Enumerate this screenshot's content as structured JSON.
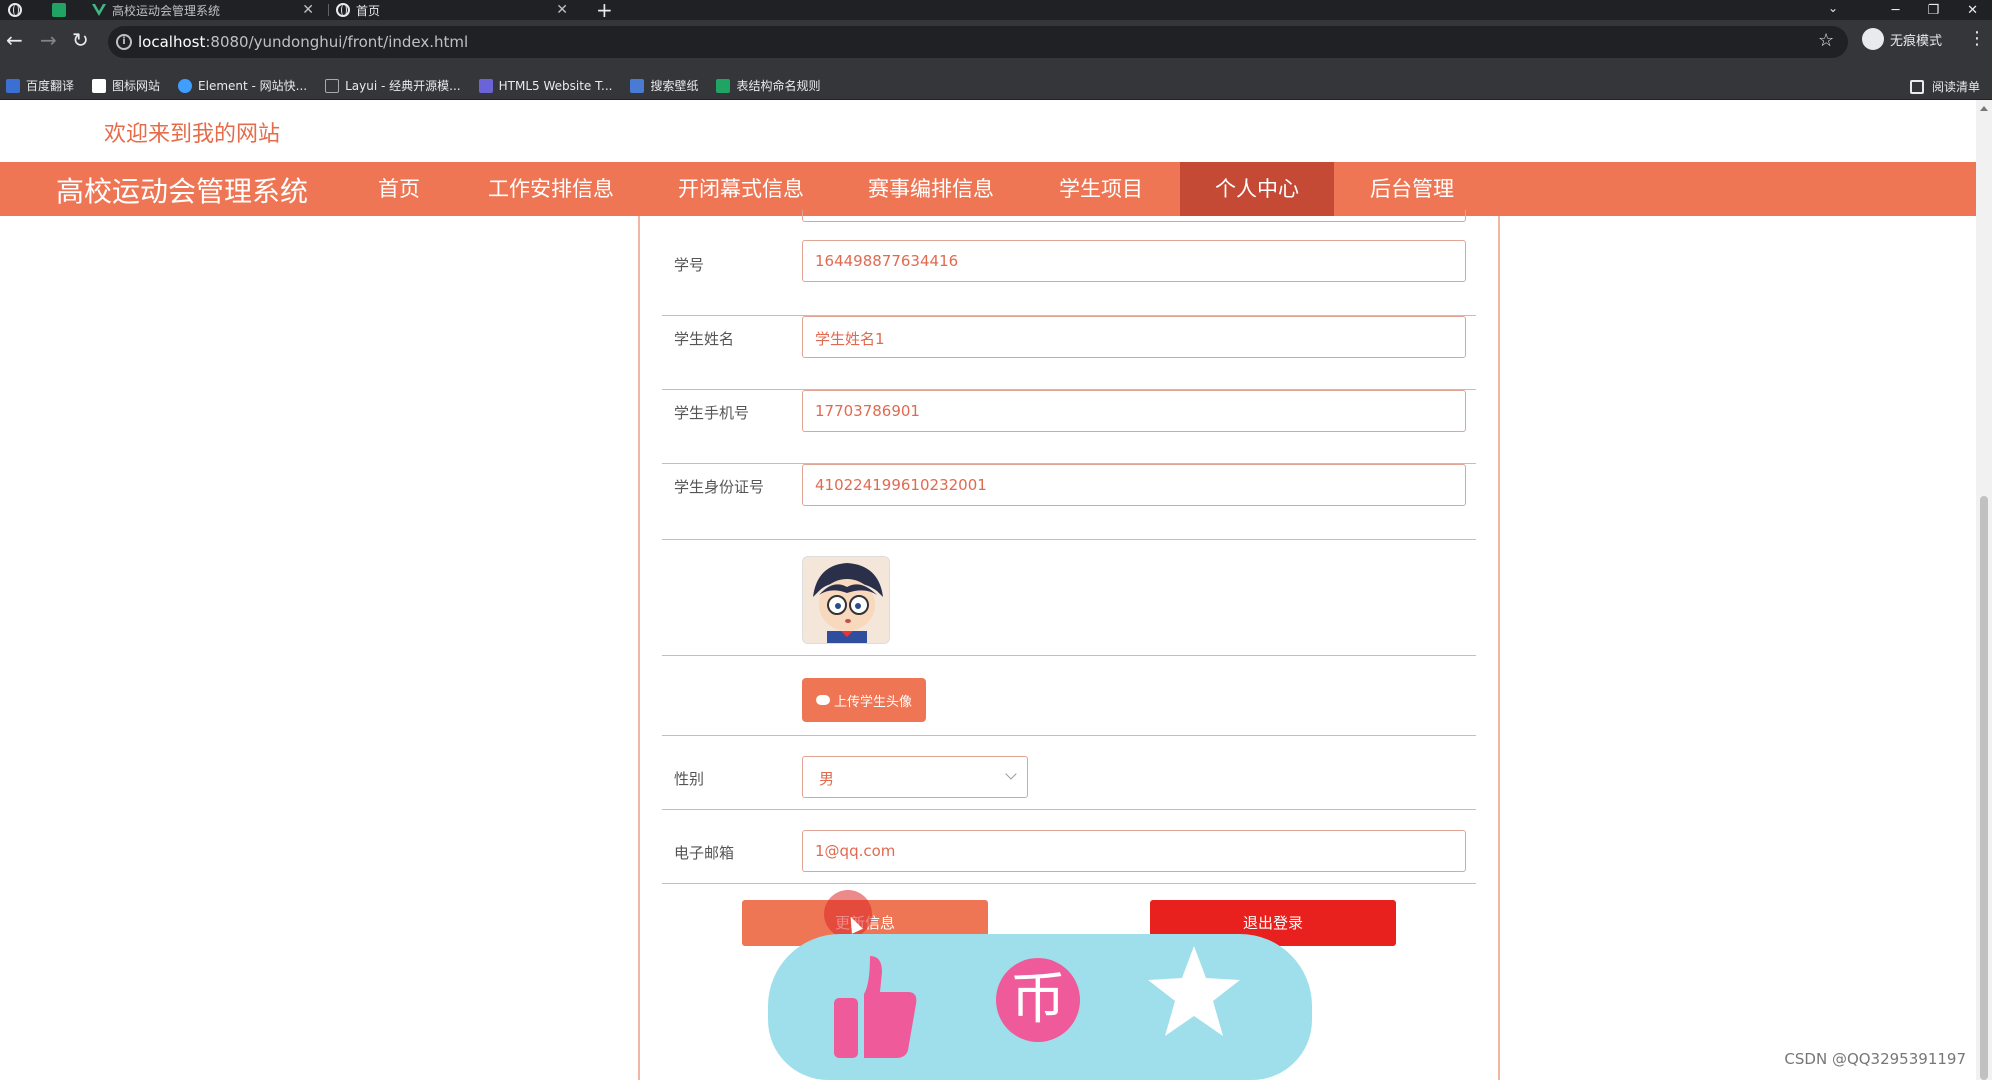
{
  "browser": {
    "tabs": [
      {
        "title": "高校运动会管理系统",
        "active": false
      },
      {
        "title": "首页",
        "active": true
      }
    ],
    "url_host": "localhost",
    "url_path": ":8080/yundonghui/front/index.html",
    "profile_label": "无痕模式",
    "bookmarks": [
      "百度翻译",
      "图标网站",
      "Element - 网站快...",
      "Layui - 经典开源模...",
      "HTML5 Website T...",
      "搜索壁纸",
      "表结构命名规则"
    ],
    "reading_list": "阅读清单"
  },
  "site": {
    "welcome": "欢迎来到我的网站",
    "brand": "高校运动会管理系统",
    "nav": [
      {
        "label": "首页",
        "active": false
      },
      {
        "label": "工作安排信息",
        "active": false
      },
      {
        "label": "开闭幕式信息",
        "active": false
      },
      {
        "label": "赛事编排信息",
        "active": false
      },
      {
        "label": "学生项目",
        "active": false
      },
      {
        "label": "个人中心",
        "active": true
      },
      {
        "label": "后台管理",
        "active": false
      }
    ]
  },
  "form": {
    "student_id": {
      "label": "学号",
      "value": "164498877634416"
    },
    "student_name": {
      "label": "学生姓名",
      "value": "学生姓名1"
    },
    "student_phone": {
      "label": "学生手机号",
      "value": "17703786901"
    },
    "student_idcard": {
      "label": "学生身份证号",
      "value": "410224199610232001"
    },
    "upload_label": "上传学生头像",
    "gender": {
      "label": "性别",
      "value": "男"
    },
    "email": {
      "label": "电子邮箱",
      "value": "1@qq.com"
    },
    "update_button": "更新信息",
    "logout_button": "退出登录"
  },
  "colors": {
    "accent": "#ef7654",
    "nav_active": "#c54a35",
    "logout": "#e8201e",
    "panel": "#9edfeb"
  },
  "overlay_icons": [
    "thumbs-up-icon",
    "coin-icon",
    "star-icon"
  ],
  "watermark": "CSDN @QQ3295391197"
}
